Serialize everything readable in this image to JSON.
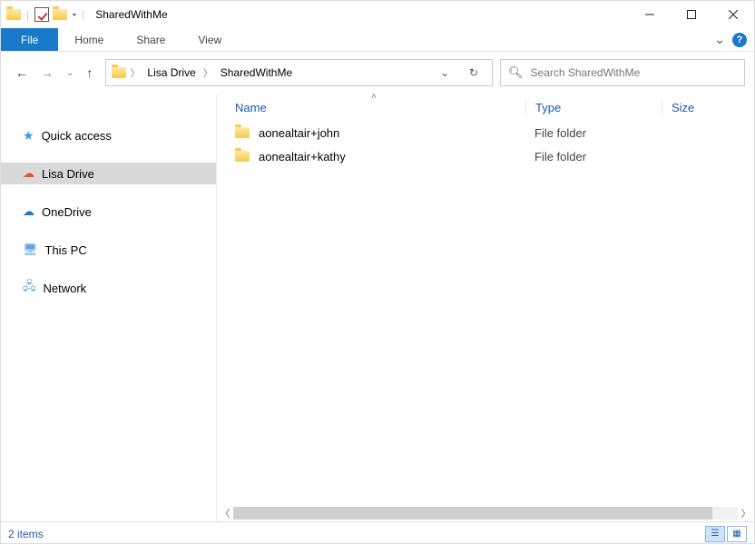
{
  "window": {
    "title": "SharedWithMe"
  },
  "ribbon": {
    "file": "File",
    "tabs": [
      "Home",
      "Share",
      "View"
    ]
  },
  "address": {
    "segments": [
      "Lisa Drive",
      "SharedWithMe"
    ]
  },
  "search": {
    "placeholder": "Search SharedWithMe"
  },
  "nav_pane": {
    "quick_access": "Quick access",
    "lisa_drive": "Lisa Drive",
    "onedrive": "OneDrive",
    "this_pc": "This PC",
    "network": "Network"
  },
  "columns": {
    "name": "Name",
    "type": "Type",
    "size": "Size"
  },
  "items": [
    {
      "name": "aonealtair+john",
      "type": "File folder"
    },
    {
      "name": "aonealtair+kathy",
      "type": "File folder"
    }
  ],
  "status": {
    "count_text": "2 items"
  }
}
